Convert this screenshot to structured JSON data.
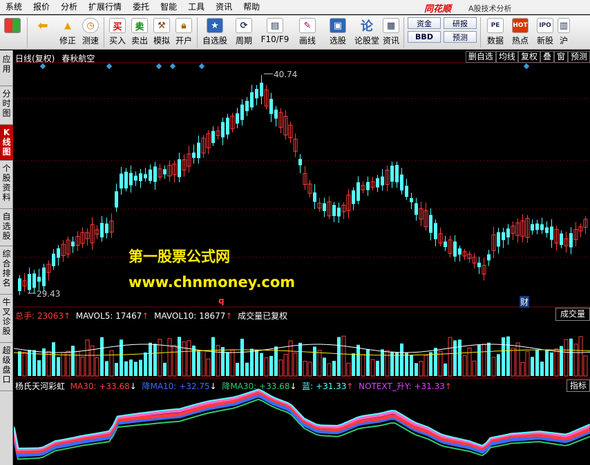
{
  "menu": [
    "系统",
    "报价",
    "分析",
    "扩展行情",
    "委托",
    "智能",
    "工具",
    "资讯",
    "帮助"
  ],
  "brand": "同花顺",
  "app_title": "A股技术分析",
  "toolbar": [
    {
      "label": "",
      "icon": "grid-icon"
    },
    {
      "label": "",
      "icon": "back-icon"
    },
    {
      "label": "修正",
      "icon": "up-icon"
    },
    {
      "label": "测速",
      "icon": "clock-icon"
    },
    {
      "label": "买入",
      "icon": "buy-icon"
    },
    {
      "label": "卖出",
      "icon": "sell-icon"
    },
    {
      "label": "模拟",
      "icon": "hammer-icon"
    },
    {
      "label": "开户",
      "icon": "lock-icon"
    },
    {
      "label": "自选股",
      "icon": "star-icon"
    },
    {
      "label": "周期",
      "icon": "cycle-icon"
    },
    {
      "label": "F10/F9",
      "icon": "f10-icon"
    },
    {
      "label": "画线",
      "icon": "pen-icon"
    },
    {
      "label": "选股",
      "icon": "monitor-icon"
    },
    {
      "label": "论股堂",
      "icon": "forum-icon"
    },
    {
      "label": "资讯",
      "icon": "news-icon"
    }
  ],
  "toolbar_boxes": [
    [
      "资金",
      "BBD"
    ],
    [
      "研报",
      "预测"
    ]
  ],
  "toolbar_right": [
    {
      "label": "数据",
      "icon": "pe-icon"
    },
    {
      "label": "热点",
      "icon": "hot-icon"
    },
    {
      "label": "新股",
      "icon": "ipo-icon"
    },
    {
      "label": "沪",
      "icon": "sh-icon"
    }
  ],
  "sidebar": [
    "应用",
    "分时图",
    "K线图",
    "个股资料",
    "自选股",
    "综合排名",
    "牛叉诊股",
    "超级盘口"
  ],
  "sidebar_active": 2,
  "kline": {
    "header": "日线(复权)",
    "name": "春秋航空",
    "tabs": [
      "删自选",
      "均线",
      "复权",
      "叠",
      "窗",
      "预测"
    ],
    "high_label": "40.74",
    "low_label": "29.43",
    "high": 40.74,
    "low": 29.43,
    "q_marker": "q",
    "cai_marker": "财",
    "colors": {
      "up": "#ff3b3b",
      "down": "#54ffff"
    }
  },
  "volume": {
    "total_label": "总手:",
    "total": "23063",
    "mavol5_label": "MAVOL5:",
    "mavol5": "17467",
    "mavol10_label": "MAVOL10:",
    "mavol10": "18677",
    "note": "成交量已复权",
    "button": "成交量"
  },
  "indicator": {
    "name": "杨氏天河彩虹",
    "ma30_label": "MA30:",
    "ma30": "+33.68",
    "ma10_label": "降MA10:",
    "ma10": "+32.75",
    "ma30b_label": "降MA30:",
    "ma30b": "+33.68",
    "blue_label": "蓝:",
    "blue": "+31.33",
    "notext_label": "NOTEXT_升Y:",
    "notext": "+31.33",
    "button": "指标"
  },
  "watermark": {
    "line1": "第一股票公式网",
    "line2": "www.chnmoney.com"
  }
}
